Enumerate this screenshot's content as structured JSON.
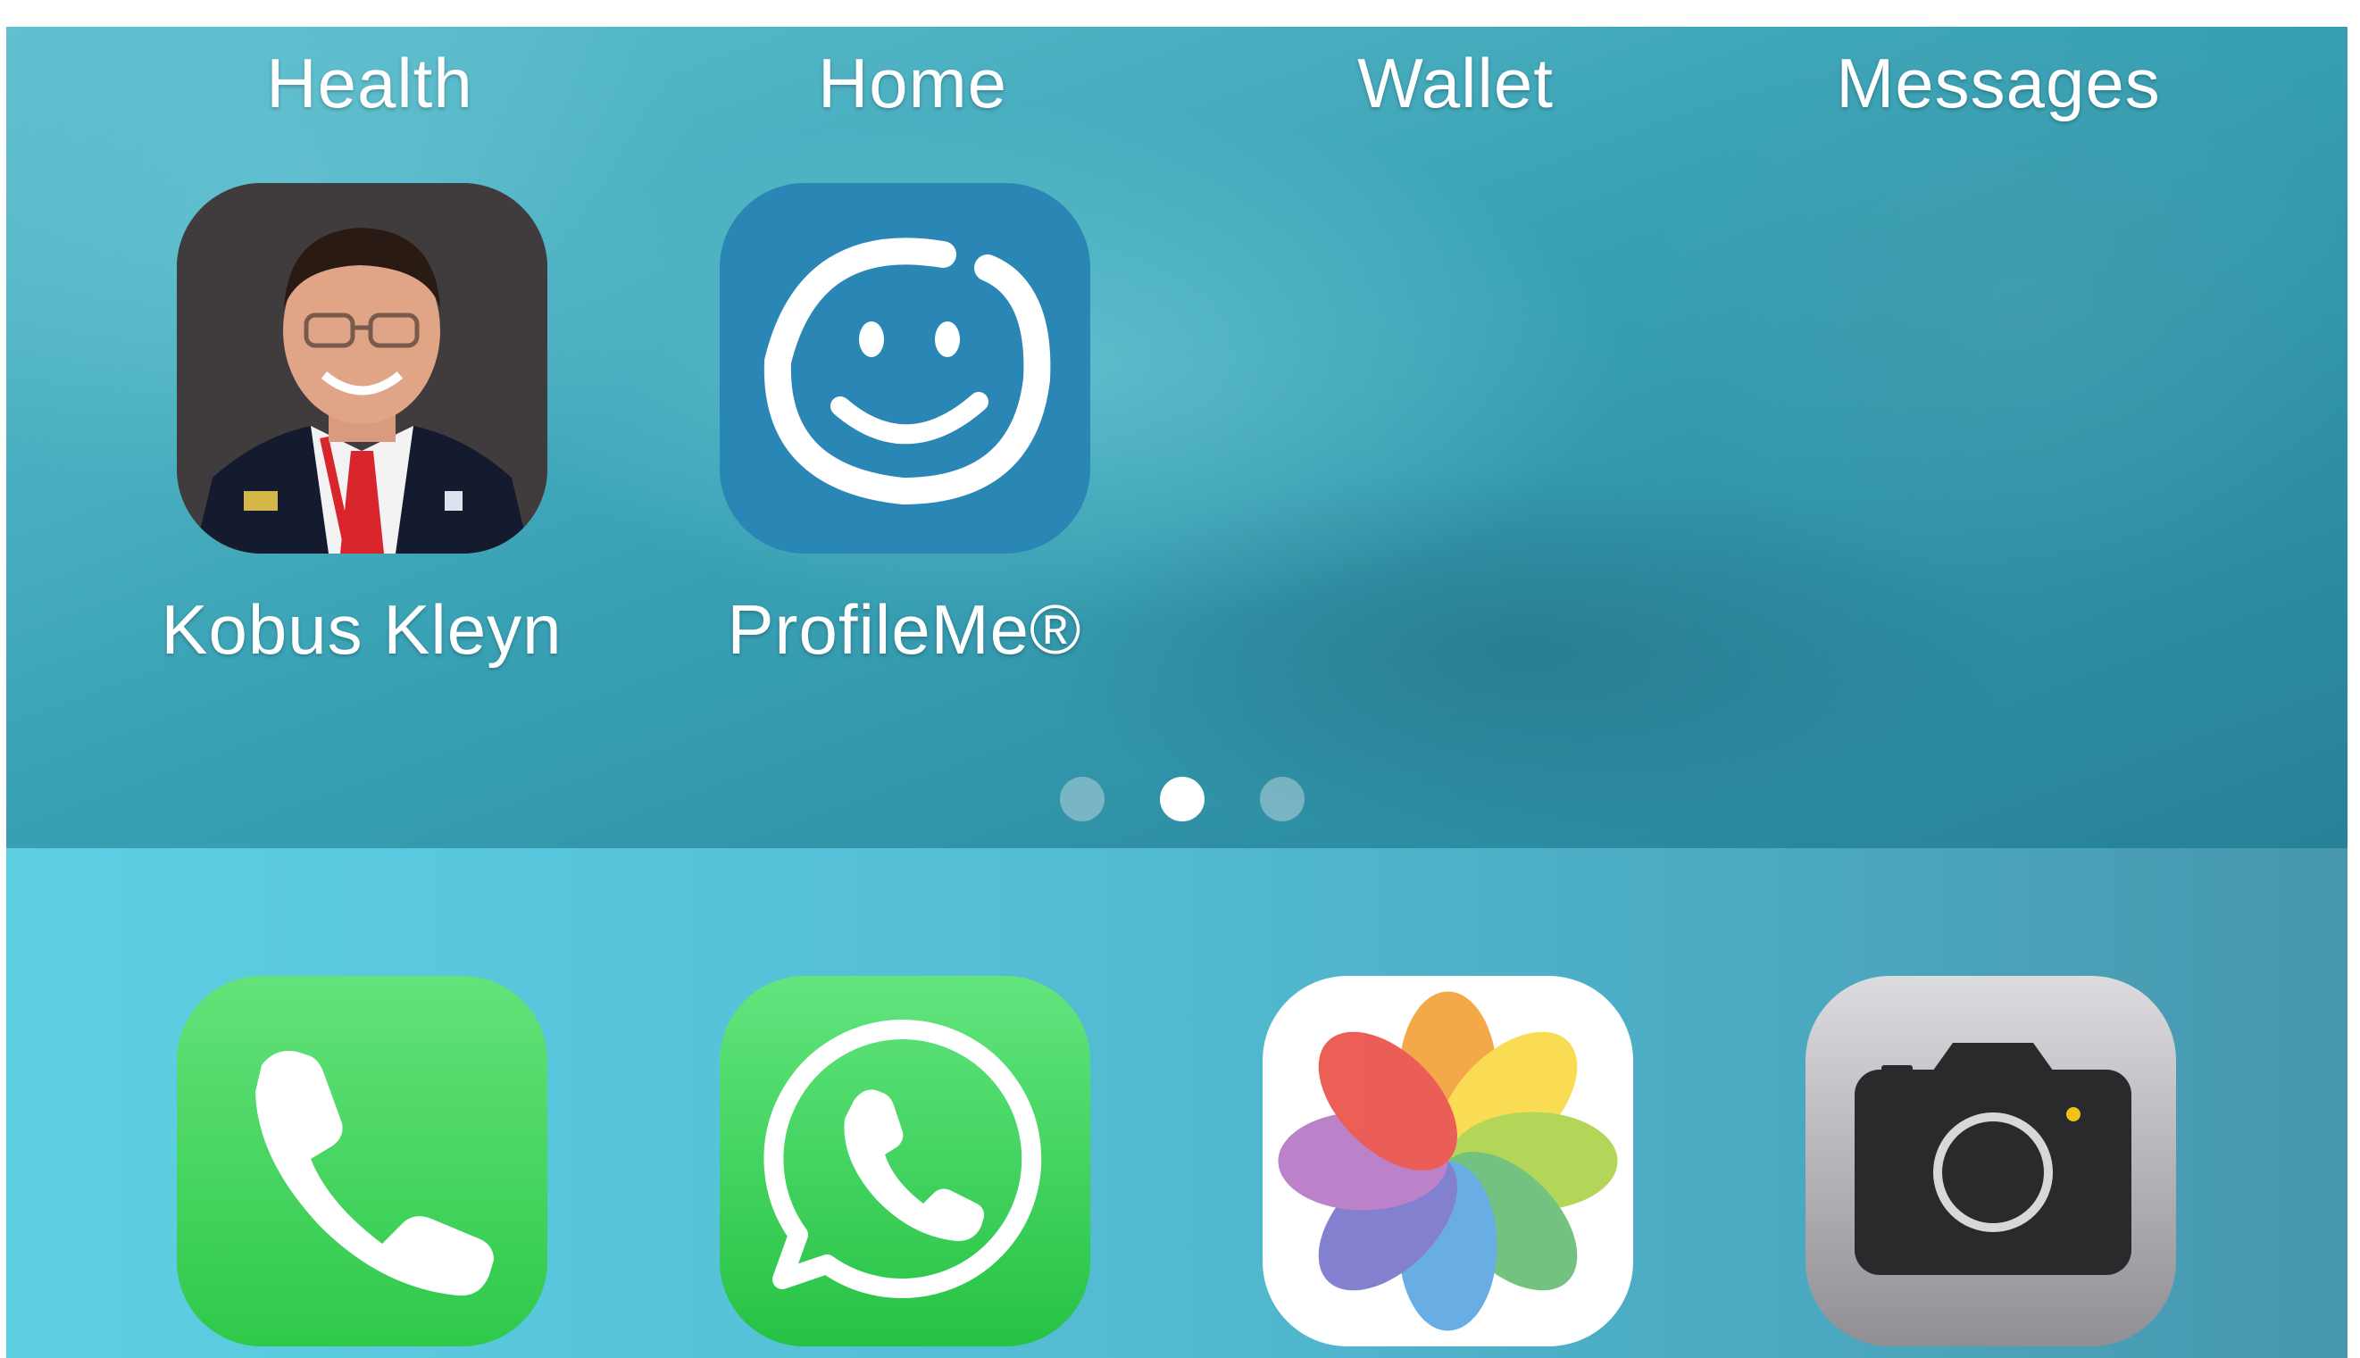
{
  "top_row_labels": [
    {
      "name": "label-health",
      "text": "Health"
    },
    {
      "name": "label-home",
      "text": "Home"
    },
    {
      "name": "label-wallet",
      "text": "Wallet"
    },
    {
      "name": "label-messages",
      "text": "Messages"
    }
  ],
  "apps": [
    {
      "label": "Kobus Kleyn",
      "icon": "contact-photo-icon"
    },
    {
      "label": "ProfileMe®",
      "icon": "smiley-face-icon",
      "color": "#2a86b4"
    }
  ],
  "page_indicator": {
    "pages": 3,
    "current": 2
  },
  "dock": [
    {
      "app": "Phone",
      "icon": "phone-icon",
      "color": "#35cf4f"
    },
    {
      "app": "WhatsApp",
      "icon": "whatsapp-icon",
      "color": "#33d05a"
    },
    {
      "app": "Photos",
      "icon": "photos-flower-icon",
      "color": "#ffffff"
    },
    {
      "app": "Camera",
      "icon": "camera-icon",
      "color": "#9e9ea3"
    }
  ],
  "colors": {
    "wallpaper": "#3aa2b5",
    "dock": "#55bfd6",
    "label_text": "#ffffff"
  }
}
